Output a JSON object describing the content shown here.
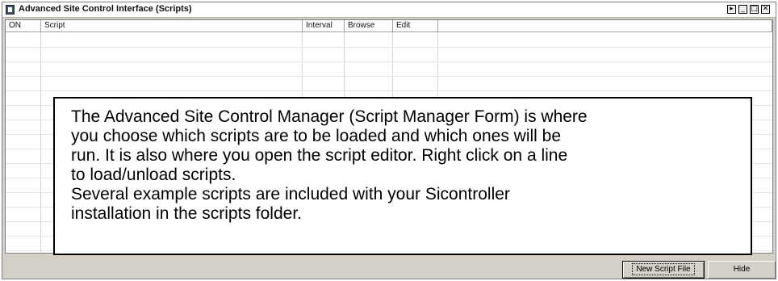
{
  "window": {
    "title": "Advanced Site Control Interface (Scripts)",
    "controls": [
      "▸",
      "_",
      "□",
      "✕"
    ]
  },
  "table": {
    "columns": [
      "ON",
      "Script",
      "Interval",
      "Browse",
      "Edit"
    ]
  },
  "callout": {
    "lines": [
      "The Advanced Site Control Manager (Script Manager Form) is where",
      "you choose which scripts are to be loaded and which ones will be",
      "run.  It is also where you open the script editor.  Right click on a line",
      "to load/unload scripts.",
      "Several example scripts are included with your Sicontroller",
      "installation in the scripts folder."
    ]
  },
  "footer": {
    "new_script_label": "New Script File",
    "hide_label": "Hide"
  }
}
